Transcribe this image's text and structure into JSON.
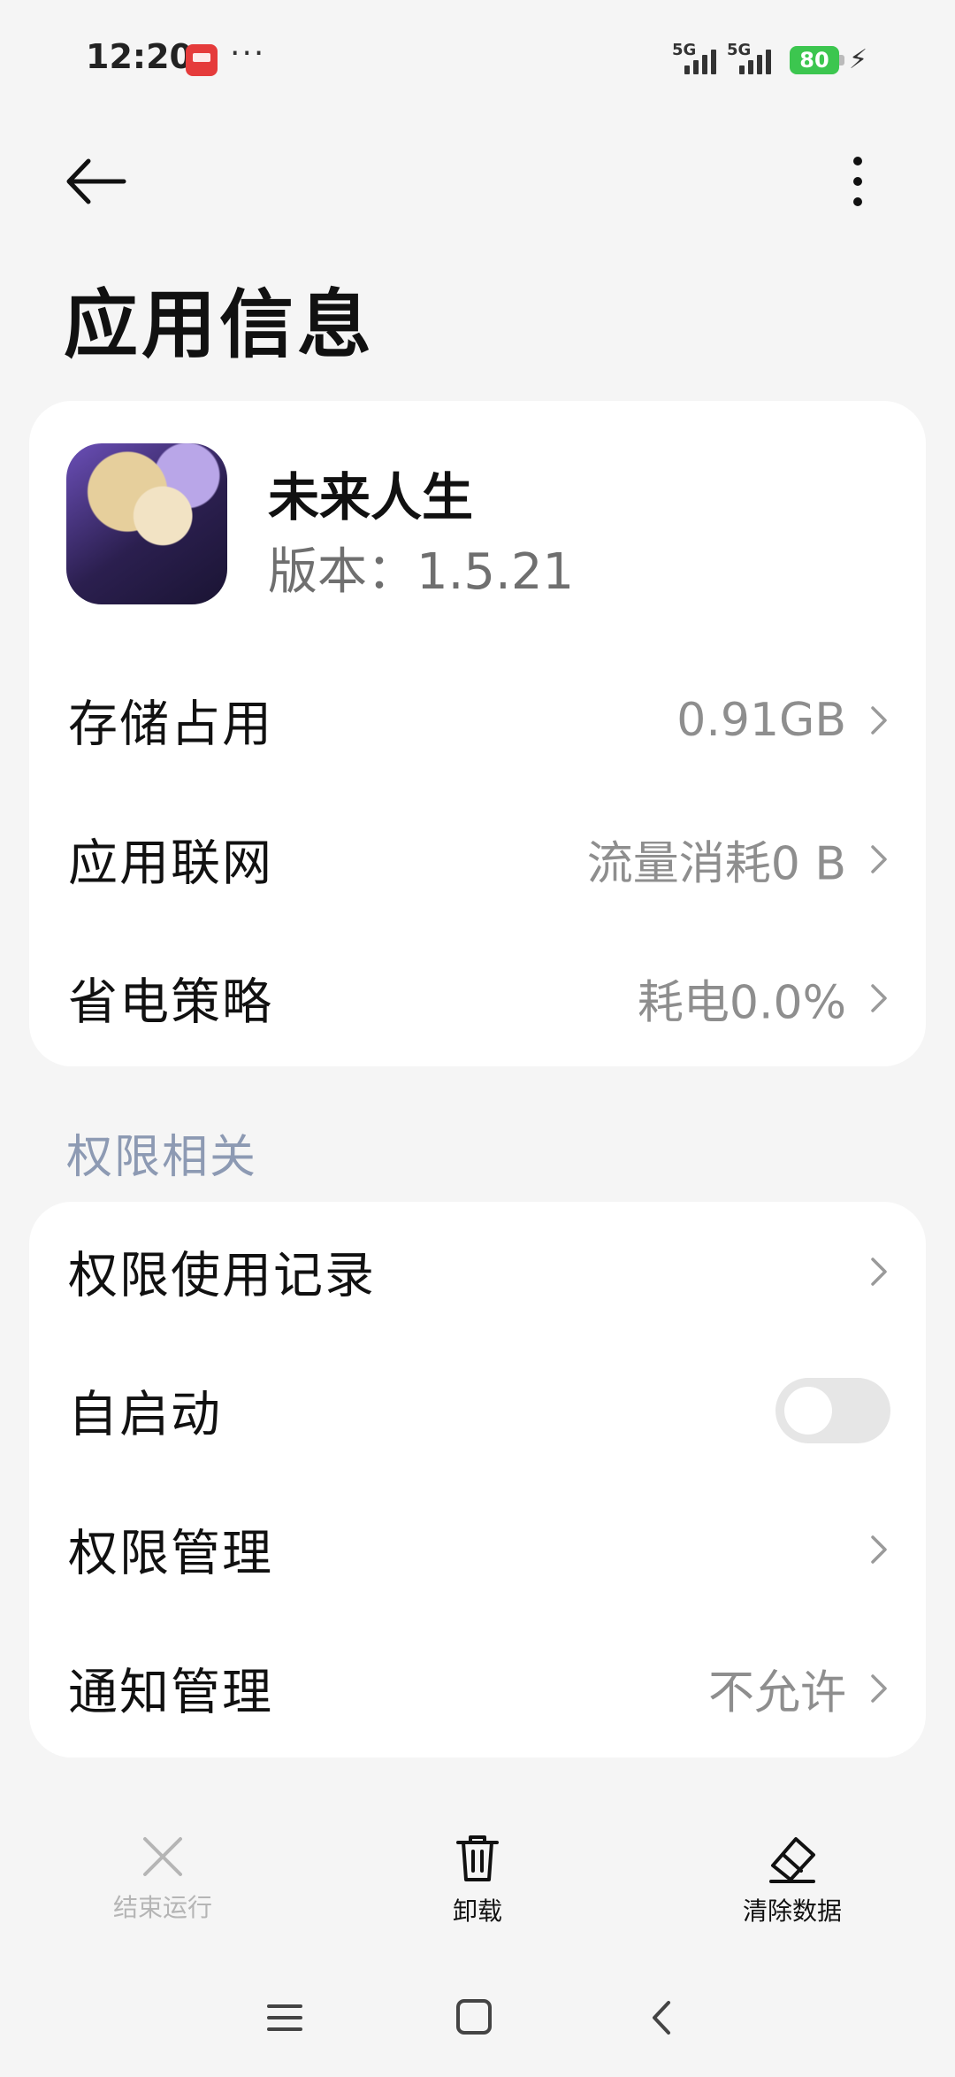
{
  "status_bar": {
    "time": "12:20",
    "more": "···",
    "signal_1": "5G",
    "signal_2": "5G",
    "battery": "80",
    "battery_color": "#3cc64f"
  },
  "header": {
    "title": "应用信息"
  },
  "app": {
    "name": "未来人生",
    "version": "版本：1.5.21"
  },
  "info_rows": [
    {
      "label": "存储占用",
      "value": "0.91GB"
    },
    {
      "label": "应用联网",
      "value": "流量消耗0 B"
    },
    {
      "label": "省电策略",
      "value": "耗电0.0%"
    }
  ],
  "permissions": {
    "section_title": "权限相关",
    "rows": [
      {
        "label": "权限使用记录",
        "value": ""
      },
      {
        "label": "自启动",
        "value": "",
        "toggle": false
      },
      {
        "label": "权限管理",
        "value": ""
      },
      {
        "label": "通知管理",
        "value": "不允许"
      }
    ]
  },
  "actions": {
    "force_stop": "结束运行",
    "uninstall": "卸载",
    "clear_data": "清除数据"
  },
  "colors": {
    "background": "#f5f5f5",
    "section_header": "#8d9ab3",
    "secondary_text": "#8e8e8e",
    "disabled": "#b5b5b5"
  }
}
